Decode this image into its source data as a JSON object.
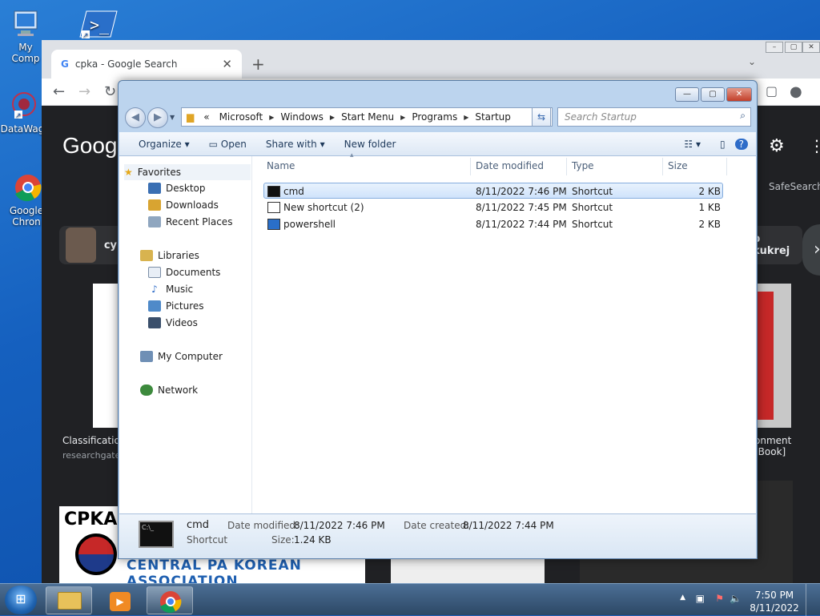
{
  "desktop": {
    "icons": [
      {
        "label": "My Comp",
        "icon": "computer-icon"
      },
      {
        "label": "",
        "icon": "powershell-icon"
      },
      {
        "label": "DataWag",
        "icon": "datawag-icon"
      },
      {
        "label": "Google Chron",
        "icon": "chrome-icon"
      }
    ]
  },
  "chrome": {
    "tab_title": "cpka - Google Search",
    "logo": "Goog",
    "safesearch": "SafeSearch",
    "chips": [
      "cy",
      "p kukrej"
    ],
    "captions": {
      "left": "Classificatio",
      "left_source": "researchgate.",
      "right": "onment [Book]"
    },
    "cpka_logo": "CPKA",
    "banner": "CENTRAL PA KOREAN ASSOCIATION"
  },
  "explorer": {
    "address": {
      "prefix": "«",
      "segments": [
        "Microsoft",
        "Windows",
        "Start Menu",
        "Programs",
        "Startup"
      ]
    },
    "search_placeholder": "Search Startup",
    "commands": {
      "organize": "Organize",
      "open": "Open",
      "share_with": "Share with",
      "new_folder": "New folder"
    },
    "nav": {
      "favorites": "Favorites",
      "desktop": "Desktop",
      "downloads": "Downloads",
      "recent_places": "Recent Places",
      "libraries": "Libraries",
      "documents": "Documents",
      "music": "Music",
      "pictures": "Pictures",
      "videos": "Videos",
      "my_computer": "My Computer",
      "network": "Network"
    },
    "columns": {
      "name": "Name",
      "date_modified": "Date modified",
      "type": "Type",
      "size": "Size"
    },
    "files": [
      {
        "name": "cmd",
        "date": "8/11/2022 7:46 PM",
        "type": "Shortcut",
        "size": "2 KB",
        "selected": true
      },
      {
        "name": "New shortcut (2)",
        "date": "8/11/2022 7:45 PM",
        "type": "Shortcut",
        "size": "1 KB",
        "selected": false
      },
      {
        "name": "powershell",
        "date": "8/11/2022 7:44 PM",
        "type": "Shortcut",
        "size": "2 KB",
        "selected": false
      }
    ],
    "details": {
      "name": "cmd",
      "type": "Shortcut",
      "date_modified_label": "Date modified:",
      "date_modified": "8/11/2022 7:46 PM",
      "size_label": "Size:",
      "size": "1.24 KB",
      "date_created_label": "Date created:",
      "date_created": "8/11/2022 7:44 PM"
    }
  },
  "taskbar": {
    "time": "7:50 PM",
    "date": "8/11/2022"
  }
}
